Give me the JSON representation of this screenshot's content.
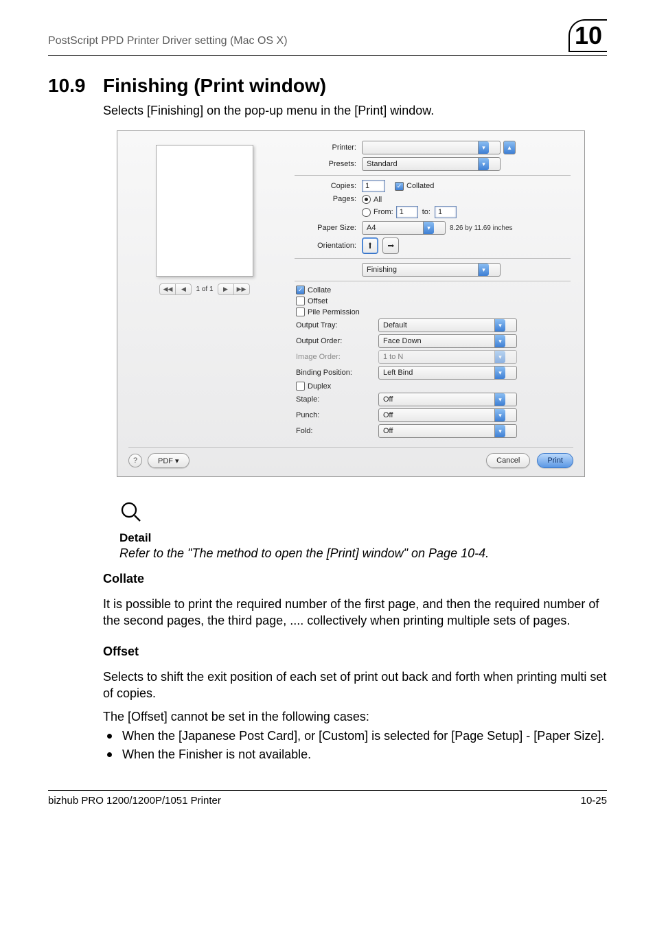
{
  "header": {
    "breadcrumb": "PostScript PPD Printer Driver setting (Mac OS X)",
    "chapter_num": "10"
  },
  "section": {
    "number": "10.9",
    "title": "Finishing (Print window)",
    "subtitle": "Selects [Finishing] on the pop-up menu in the [Print] window."
  },
  "dialog": {
    "labels": {
      "printer": "Printer:",
      "presets": "Presets:",
      "copies": "Copies:",
      "collated": "Collated",
      "pages": "Pages:",
      "all": "All",
      "from": "From:",
      "to": "to:",
      "paper_size": "Paper Size:",
      "orientation": "Orientation:"
    },
    "values": {
      "printer": "",
      "presets": "Standard",
      "copies": "1",
      "from": "1",
      "to": "1",
      "paper_size": "A4",
      "paper_size_note": "8.26 by 11.69 inches"
    },
    "panel_selected": "Finishing",
    "finishing": {
      "collate_label": "Collate",
      "offset_label": "Offset",
      "pile_label": "Pile Permission",
      "rows": {
        "output_tray": {
          "label": "Output Tray:",
          "value": "Default"
        },
        "output_order": {
          "label": "Output Order:",
          "value": "Face Down"
        },
        "image_order": {
          "label": "Image Order:",
          "value": "1 to N"
        },
        "binding_pos": {
          "label": "Binding Position:",
          "value": "Left Bind"
        },
        "duplex_label": "Duplex",
        "staple": {
          "label": "Staple:",
          "value": "Off"
        },
        "punch": {
          "label": "Punch:",
          "value": "Off"
        },
        "fold": {
          "label": "Fold:",
          "value": "Off"
        }
      }
    },
    "pager": "1 of 1",
    "buttons": {
      "pdf": "PDF ▾",
      "cancel": "Cancel",
      "print": "Print"
    }
  },
  "detail": {
    "heading": "Detail",
    "text": "Refer to the \"The method to open the [Print] window\" on Page 10-4."
  },
  "collate": {
    "heading": "Collate",
    "text": "It is possible to print the required number of the first page, and then the required number of the second pages, the third page, .... collectively when printing multiple sets of pages."
  },
  "offset": {
    "heading": "Offset",
    "text1": "Selects to shift the exit position of each set of print out back and forth when printing multi set of copies.",
    "text2": "The [Offset] cannot be set in the following cases:",
    "bullets": [
      "When the [Japanese Post Card], or [Custom] is selected for [Page Setup] - [Paper Size].",
      "When the Finisher is not available."
    ]
  },
  "footer": {
    "product": "bizhub PRO 1200/1200P/1051 Printer",
    "pagenum": "10-25"
  }
}
